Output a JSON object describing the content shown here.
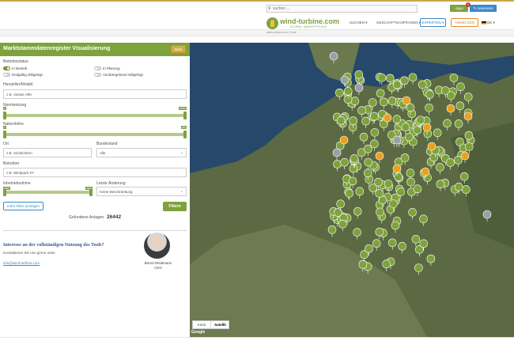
{
  "header": {
    "search_placeholder": "suchen ...",
    "apps_label": "Apps",
    "apps_badge": "1",
    "insert_label": "Inserieren",
    "logo_name": "wind-turbine.com",
    "logo_tagline": "GLOBAL MARKETPLACE",
    "nav": [
      {
        "label": "SUCHEN",
        "caret": "▾"
      },
      {
        "label": "GESCHÄFTSANFRAGEN",
        "caret": "▾"
      }
    ],
    "experts_label": "EXPERTEN",
    "login_label": "ANMELDEN",
    "language": "DE",
    "breadcrumb": "wind-turbine.com  |  Tools"
  },
  "panel": {
    "title": "Marktstammdatenregister Visualisierung",
    "badge": "Beta",
    "status_label": "Betriebsstatus",
    "status_options": [
      {
        "label": "In Betrieb",
        "on": true
      },
      {
        "label": "In Planung",
        "on": false
      },
      {
        "label": "Endgültig stillgelegt",
        "on": false
      },
      {
        "label": "Vorübergehend stillgelegt",
        "on": false
      }
    ],
    "manufacturer_label": "Hersteller/Modell",
    "manufacturer_placeholder": "z.B. Vestas V80",
    "power_label": "Nennleistung",
    "power_min": "0",
    "power_max": "15000",
    "hub_label": "Nabenhöhe",
    "hub_min": "0",
    "hub_max": "200",
    "location_label": "Ort",
    "location_placeholder": "z.B. Schlüchtern",
    "state_label": "Bundesland",
    "state_value": "Alle",
    "operator_label": "Betreiber",
    "operator_placeholder": "z.B. Windpark XY",
    "commission_label": "Inbetriebnahme",
    "commission_min": "1980",
    "commission_max": "2023",
    "last_change_label": "Letzte Änderung",
    "last_change_value": "Keine Beschränkung",
    "more_filters": "mehr Filter anzeigen",
    "filter_button": "Filtern",
    "found_label": "Gefundene Anlagen:",
    "found_count": "26442",
    "promo_title": "Interesse an der vollständigen Nutzung des Tools?",
    "promo_text": "Kontaktieren Sie uns gerne unter",
    "promo_email": "info@wind-turbine.com",
    "contact_name": "Bernd Weidmann",
    "contact_role": "CEO"
  },
  "map": {
    "type_map": "Karte",
    "type_satellite": "Satellit",
    "attribution": "Google"
  },
  "colors": {
    "brand_green": "#7ea23c",
    "accent_blue": "#3a8ac9",
    "accent_orange": "#e08a2a",
    "marker_orange": "#e9a21e",
    "marker_gray": "#9aa0a6"
  }
}
